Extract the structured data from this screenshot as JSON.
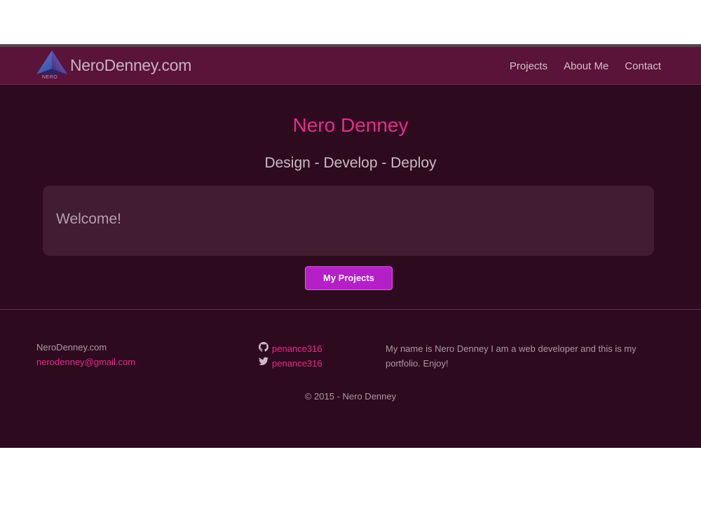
{
  "colors": {
    "background": "#2e0a1f",
    "navbar": "#5a1339",
    "accent_pink": "#e52c8c",
    "button": "#b51fc8",
    "welcome_panel": "#421c31"
  },
  "header": {
    "logo_icon": "triangle-logo-icon",
    "logo_text": "NERO",
    "brand": "NeroDenney.com",
    "nav": [
      {
        "label": "Projects"
      },
      {
        "label": "About Me"
      },
      {
        "label": "Contact"
      }
    ]
  },
  "hero": {
    "title": "Nero Denney",
    "subtitle": "Design - Develop - Deploy",
    "welcome": "Welcome!",
    "button_label": "My Projects"
  },
  "footer": {
    "site": "NeroDenney.com",
    "email": "nerodenney@gmail.com",
    "github": {
      "icon": "github-icon",
      "handle": "penance316"
    },
    "twitter": {
      "icon": "twitter-icon",
      "handle": "penance316"
    },
    "bio": "My name is Nero Denney I am a web developer and this is my portfolio. Enjoy!",
    "copyright": "© 2015 - Nero Denney"
  }
}
